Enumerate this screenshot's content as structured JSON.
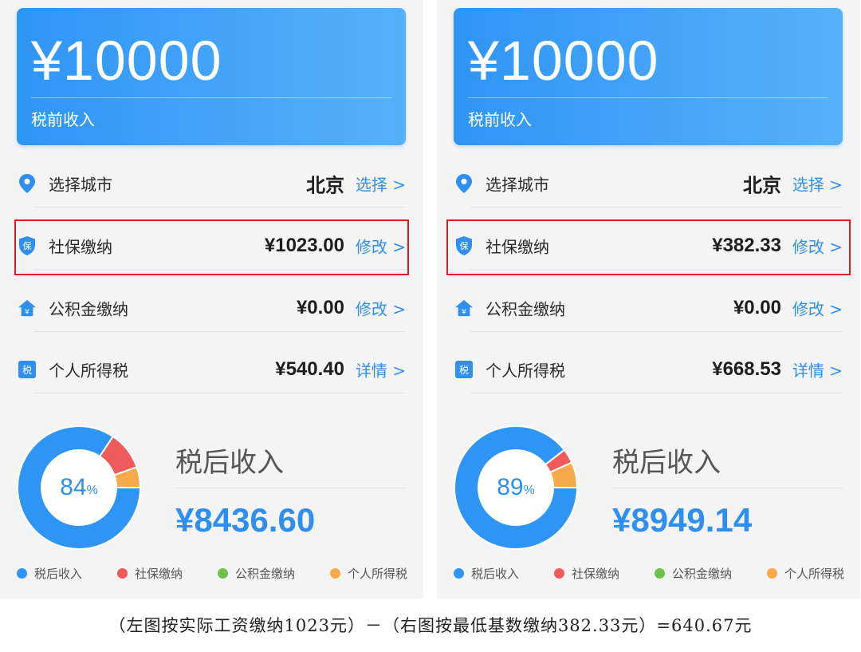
{
  "colors": {
    "accent": "#2f8ff0",
    "net_income": "#2f95f5",
    "social": "#ef5b5b",
    "fund": "#6cc24a",
    "tax": "#f7a94b",
    "highlight_border": "#dd1d1d"
  },
  "panels": {
    "left": {
      "gross": {
        "amount": "¥10000",
        "label": "税前收入"
      },
      "rows": {
        "city": {
          "icon": "location-pin-icon",
          "label": "选择城市",
          "value": "北京",
          "action": "选择 >"
        },
        "social": {
          "icon": "shield-bao-icon",
          "label": "社保缴纳",
          "value": "¥1023.00",
          "action": "修改 >"
        },
        "fund": {
          "icon": "house-yen-icon",
          "label": "公积金缴纳",
          "value": "¥0.00",
          "action": "修改 >"
        },
        "tax": {
          "icon": "tax-badge-icon",
          "label": "个人所得税",
          "value": "¥540.40",
          "action": "详情 >"
        }
      },
      "net": {
        "title": "税后收入",
        "amount": "¥8436.60",
        "percent": "84",
        "percent_unit": "%"
      },
      "chart_data": {
        "type": "pie",
        "categories": [
          "税后收入",
          "社保缴纳",
          "公积金缴纳",
          "个人所得税"
        ],
        "values": [
          8436.6,
          1023.0,
          0.0,
          540.4
        ]
      }
    },
    "right": {
      "gross": {
        "amount": "¥10000",
        "label": "税前收入"
      },
      "rows": {
        "city": {
          "icon": "location-pin-icon",
          "label": "选择城市",
          "value": "北京",
          "action": "选择 >"
        },
        "social": {
          "icon": "shield-bao-icon",
          "label": "社保缴纳",
          "value": "¥382.33",
          "action": "修改 >"
        },
        "fund": {
          "icon": "house-yen-icon",
          "label": "公积金缴纳",
          "value": "¥0.00",
          "action": "修改 >"
        },
        "tax": {
          "icon": "tax-badge-icon",
          "label": "个人所得税",
          "value": "¥668.53",
          "action": "详情 >"
        }
      },
      "net": {
        "title": "税后收入",
        "amount": "¥8949.14",
        "percent": "89",
        "percent_unit": "%"
      },
      "chart_data": {
        "type": "pie",
        "categories": [
          "税后收入",
          "社保缴纳",
          "公积金缴纳",
          "个人所得税"
        ],
        "values": [
          8949.14,
          382.33,
          0.0,
          668.53
        ]
      }
    }
  },
  "legend": [
    {
      "label": "税后收入",
      "color": "#2f95f5"
    },
    {
      "label": "社保缴纳",
      "color": "#ef5b5b"
    },
    {
      "label": "公积金缴纳",
      "color": "#6cc24a"
    },
    {
      "label": "个人所得税",
      "color": "#f7a94b"
    }
  ],
  "caption": "（左图按实际工资缴纳1023元）－（右图按最低基数缴纳382.33元）=640.67元"
}
